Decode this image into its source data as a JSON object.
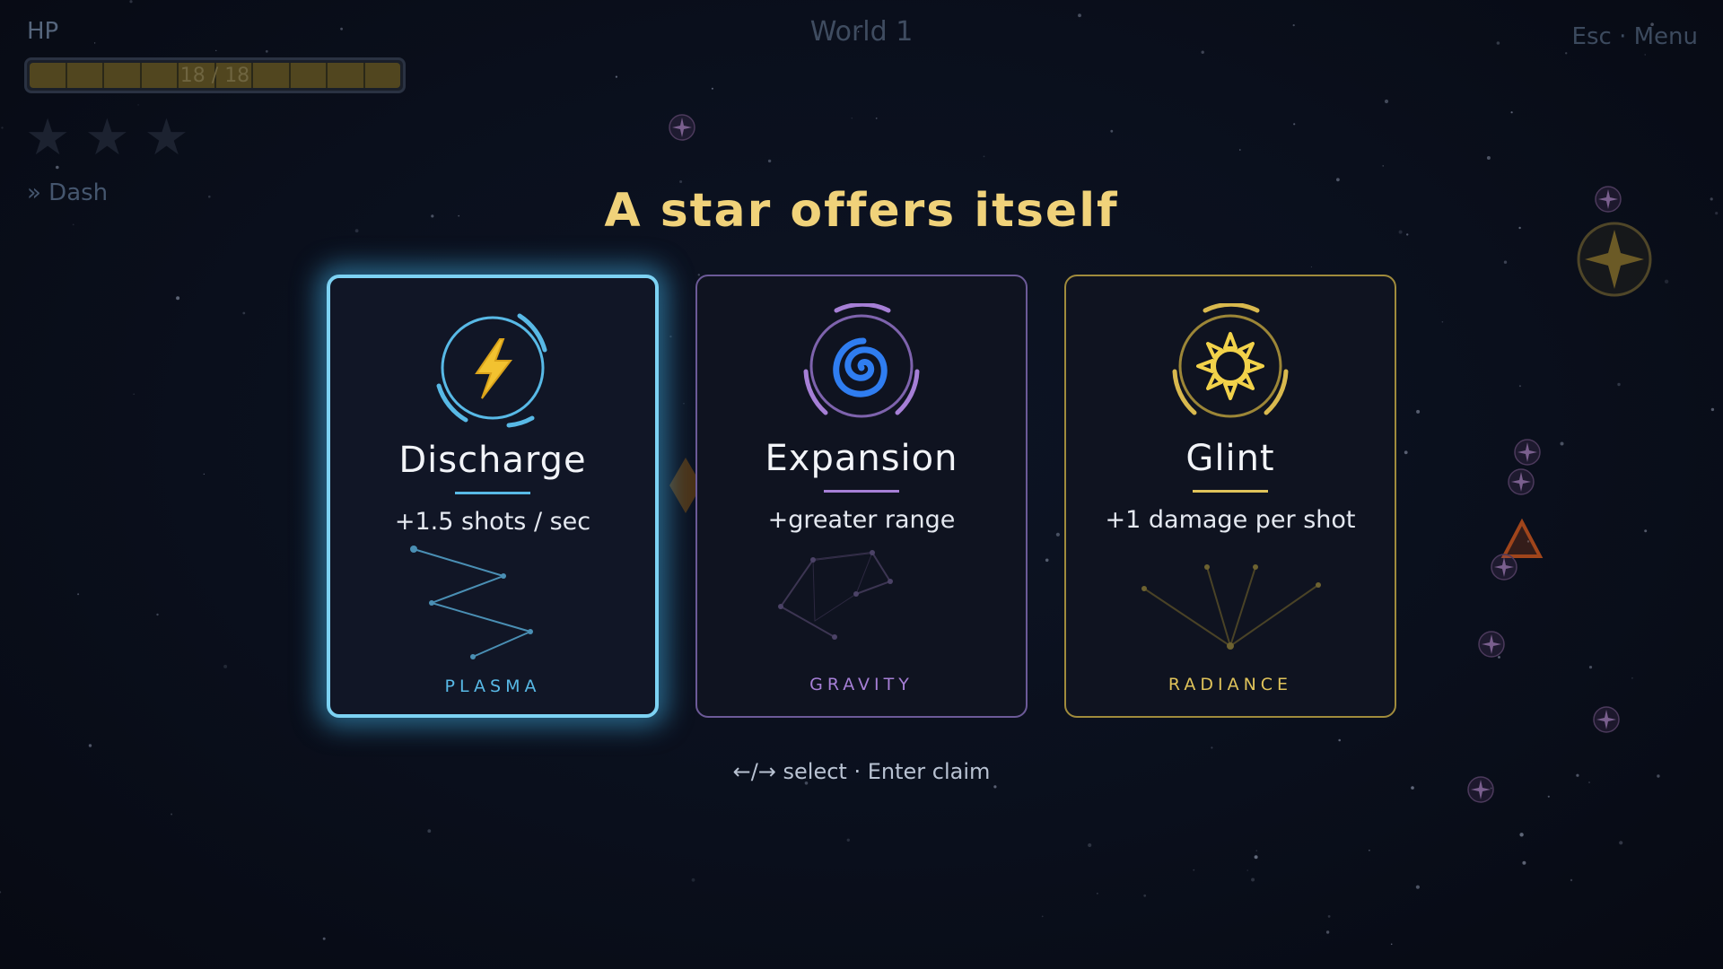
{
  "hud": {
    "hp_label": "HP",
    "hp_text": "18 / 18",
    "hp_fraction": 1.0,
    "hp_segments": 10,
    "stars_earned": 0,
    "stars_total": 3,
    "ability_label": "» Dash",
    "world_title": "World 1",
    "menu_hint": "Esc · Menu"
  },
  "overlay": {
    "heading": "A star offers itself",
    "hint": "←/→ select · Enter claim",
    "selected_index": 0
  },
  "cards": [
    {
      "name": "Discharge",
      "desc": "+1.5 shots / sec",
      "tag": "PLASMA",
      "icon": "lightning-icon",
      "color": "#58b9e6"
    },
    {
      "name": "Expansion",
      "desc": "+greater range",
      "tag": "GRAVITY",
      "icon": "spiral-icon",
      "color": "#a67fd6"
    },
    {
      "name": "Glint",
      "desc": "+1 damage per shot",
      "tag": "RADIANCE",
      "icon": "sun-icon",
      "color": "#e0c35a"
    }
  ],
  "colors": {
    "heading": "#f0d27a",
    "plasma": "#58b9e6",
    "gravity": "#a67fd6",
    "radiance": "#e0c35a"
  }
}
